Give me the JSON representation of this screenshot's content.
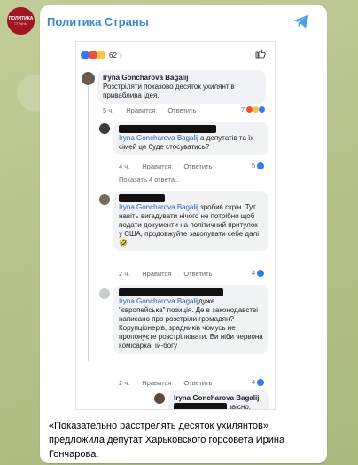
{
  "channel": {
    "name": "Политика Страны",
    "avatar_text": "ПОЛИТИКА",
    "avatar_subtext": "СТРАНЫ"
  },
  "screenshot": {
    "reactions_count": "62",
    "comments": [
      {
        "author": "Iryna Goncharova Bagalij",
        "text": "Розстріляти показово десяток ухилянтів приваблива ідея.",
        "time": "5 ч.",
        "like": "Нравится",
        "reply": "Ответить",
        "count": "7"
      },
      {
        "mention": "Iryna Goncharova Bagalij",
        "text_after": " а депутатів та їх сімей це буде стосуватись?",
        "time": "4 ч.",
        "like": "Нравится",
        "reply": "Ответить",
        "count": "5"
      },
      {
        "more": "Показать 4 ответа..."
      },
      {
        "mention": "Iryna Goncharova Bagalij",
        "text_after": " зробив скрін. Тут навіть вигадувати нічого не потрібно щоб подати документи на політичний притулок у США, продовжуйте закопувати себе далі 🤣",
        "time": "2 ч.",
        "like": "Нравится",
        "reply": "Ответить",
        "count": "4"
      },
      {
        "mention": "Iryna Goncharova Bagalij",
        "text_after": "дуже \"європейська\" позиція. Де в законодавстві написано про розстріли громадян? Корупціонерів, зрадників чомусь не пропонуєте розстрілювати. Ви ніби червона комісарка, їй-богу",
        "time": "2 ч.",
        "like": "Нравится",
        "reply": "Ответить",
        "count": "4"
      },
      {
        "author": "Iryna Goncharova Bagalij",
        "text_tail": "звісно,"
      }
    ]
  },
  "caption": "«Показательно расстрелять десяток ухилянтов» предложила депутат Харьковского горсовета Ирина Гончарова.",
  "colors": {
    "channel_name": "#3a8ac8",
    "mention": "#2e5fa8",
    "like": "#3478f6",
    "avatar_bg": "#a01622"
  }
}
